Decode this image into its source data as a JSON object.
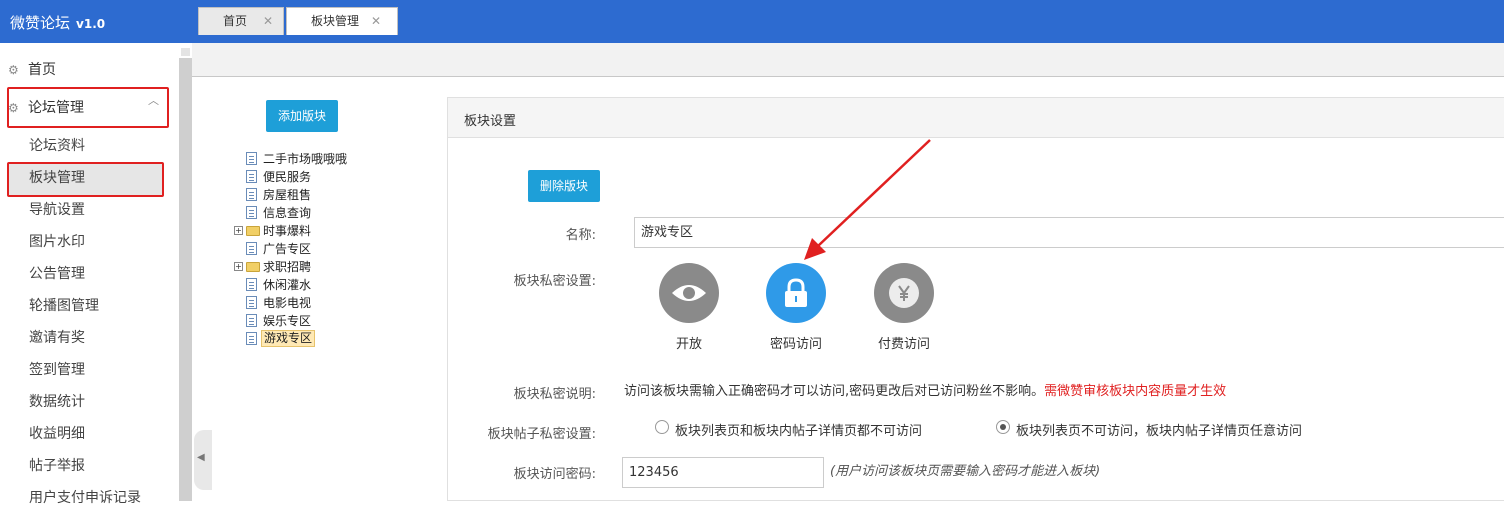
{
  "app": {
    "title": "微赞论坛",
    "version": "v1.0",
    "brand_color": "#2d6bd0"
  },
  "sidebar": {
    "home": "首页",
    "forum_mgmt": "论坛管理",
    "items": [
      "论坛资料",
      "板块管理",
      "导航设置",
      "图片水印",
      "公告管理",
      "轮播图管理",
      "邀请有奖",
      "签到管理",
      "数据统计",
      "收益明细",
      "帖子举报",
      "用户支付申诉记录"
    ]
  },
  "tabs": [
    {
      "label": "首页"
    },
    {
      "label": "板块管理"
    }
  ],
  "tree": {
    "add_button": "添加版块",
    "items": [
      {
        "label": "二手市场哦哦哦",
        "kind": "doc"
      },
      {
        "label": "便民服务",
        "kind": "doc"
      },
      {
        "label": "房屋租售",
        "kind": "doc"
      },
      {
        "label": "信息查询",
        "kind": "doc"
      },
      {
        "label": "时事爆料",
        "kind": "folder"
      },
      {
        "label": "广告专区",
        "kind": "doc"
      },
      {
        "label": "求职招聘",
        "kind": "folder"
      },
      {
        "label": "休闲灌水",
        "kind": "doc"
      },
      {
        "label": "电影电视",
        "kind": "doc"
      },
      {
        "label": "娱乐专区",
        "kind": "doc"
      },
      {
        "label": "游戏专区",
        "kind": "doc",
        "selected": true
      }
    ]
  },
  "panel": {
    "title": "板块设置",
    "delete_button": "删除版块",
    "name_label": "名称:",
    "name_value": "游戏专区",
    "privacy_label": "板块私密设置:",
    "privacy_options": [
      {
        "label": "开放",
        "icon": "eye-icon",
        "color": "#8a8a8a"
      },
      {
        "label": "密码访问",
        "icon": "lock-icon",
        "color": "#2f9ae8"
      },
      {
        "label": "付费访问",
        "icon": "yen-icon",
        "color": "#8a8a8a"
      }
    ],
    "desc_label": "板块私密说明:",
    "desc_text": "访问该板块需输入正确密码才可以访问,密码更改后对已访问粉丝不影响。",
    "desc_warning": "需微赞审核板块内容质量才生效",
    "post_privacy_label": "板块帖子私密设置:",
    "post_options": [
      {
        "label": "板块列表页和板块内帖子详情页都不可访问",
        "checked": false
      },
      {
        "label": "板块列表页不可访问，板块内帖子详情页任意访问",
        "checked": true
      }
    ],
    "password_label": "板块访问密码:",
    "password_value": "123456",
    "password_hint": "(用户访问该板块页需要输入密码才能进入板块)"
  }
}
